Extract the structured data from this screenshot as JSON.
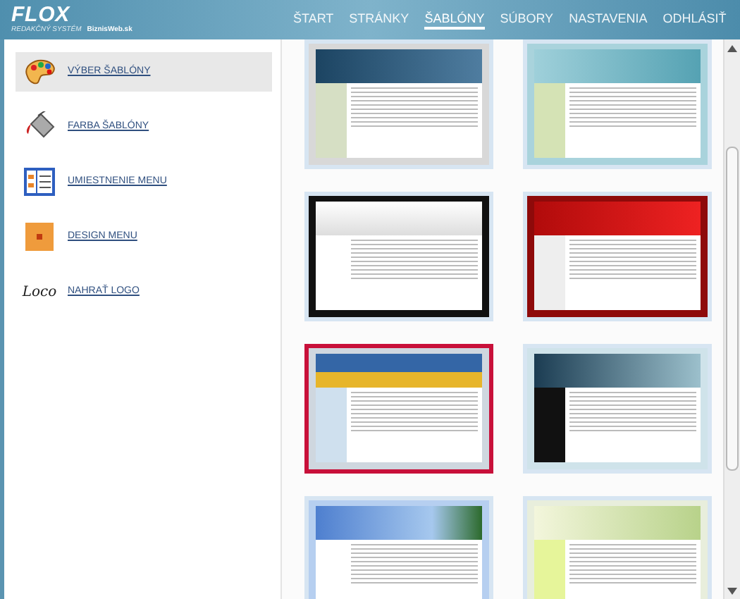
{
  "header": {
    "logo": "FLOX",
    "subtitle": "REDAKČNÝ SYSTÉM",
    "brand": "BiznisWeb.sk"
  },
  "nav": [
    {
      "label": "ŠTART",
      "selected": false
    },
    {
      "label": "STRÁNKY",
      "selected": false
    },
    {
      "label": "ŠABLÓNY",
      "selected": true
    },
    {
      "label": "SÚBORY",
      "selected": false
    },
    {
      "label": "NASTAVENIA",
      "selected": false
    },
    {
      "label": "ODHLÁSIŤ",
      "selected": false
    }
  ],
  "sidebar": {
    "items": [
      {
        "label": "VÝBER ŠABLÓNY",
        "kind": "palette",
        "selected": true
      },
      {
        "label": "FARBA ŠABLÓNY",
        "kind": "bucket",
        "selected": false
      },
      {
        "label": "UMIESTNENIE MENU",
        "kind": "layout",
        "selected": false
      },
      {
        "label": "DESIGN MENU",
        "kind": "design",
        "selected": false
      },
      {
        "label": "NAHRAŤ LOGO",
        "kind": "logo",
        "selected": false
      }
    ]
  },
  "logo_icon_text": "Loco",
  "templates": [
    {
      "kind": "navy",
      "selected": false
    },
    {
      "kind": "teal",
      "selected": false
    },
    {
      "kind": "black",
      "selected": false
    },
    {
      "kind": "red",
      "selected": false
    },
    {
      "kind": "golden",
      "selected": true
    },
    {
      "kind": "sky",
      "selected": false
    },
    {
      "kind": "beach",
      "selected": false
    },
    {
      "kind": "green",
      "selected": false
    }
  ]
}
